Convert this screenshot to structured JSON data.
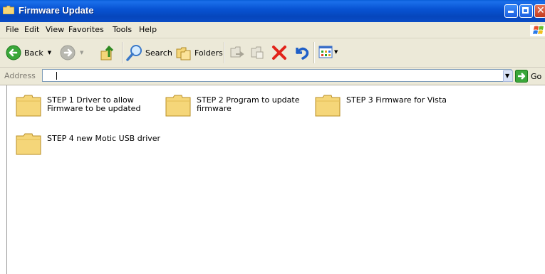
{
  "window": {
    "title": "Firmware Update"
  },
  "menu": [
    "File",
    "Edit",
    "View",
    "Favorites",
    "Tools",
    "Help"
  ],
  "toolbar": {
    "back_label": "Back",
    "search_label": "Search",
    "folders_label": "Folders"
  },
  "address": {
    "label": "Address",
    "value": "",
    "go_label": "Go"
  },
  "items": [
    {
      "label": "STEP 1  Driver to allow Firmware to be updated"
    },
    {
      "label": "STEP 2  Program to update firmware"
    },
    {
      "label": "STEP 3 Firmware for Vista"
    },
    {
      "label": "STEP 4  new Motic USB driver"
    }
  ],
  "icons": [
    "folder-icon",
    "back-arrow-icon",
    "forward-arrow-icon",
    "up-folder-icon",
    "search-icon",
    "folders-icon",
    "move-to-icon",
    "copy-to-icon",
    "delete-icon",
    "undo-icon",
    "views-icon",
    "go-arrow-icon",
    "windows-logo-icon"
  ],
  "colors": {
    "titlebar": "#0a4cc6",
    "chrome": "#ece9d8",
    "folder": "#f5d679"
  }
}
